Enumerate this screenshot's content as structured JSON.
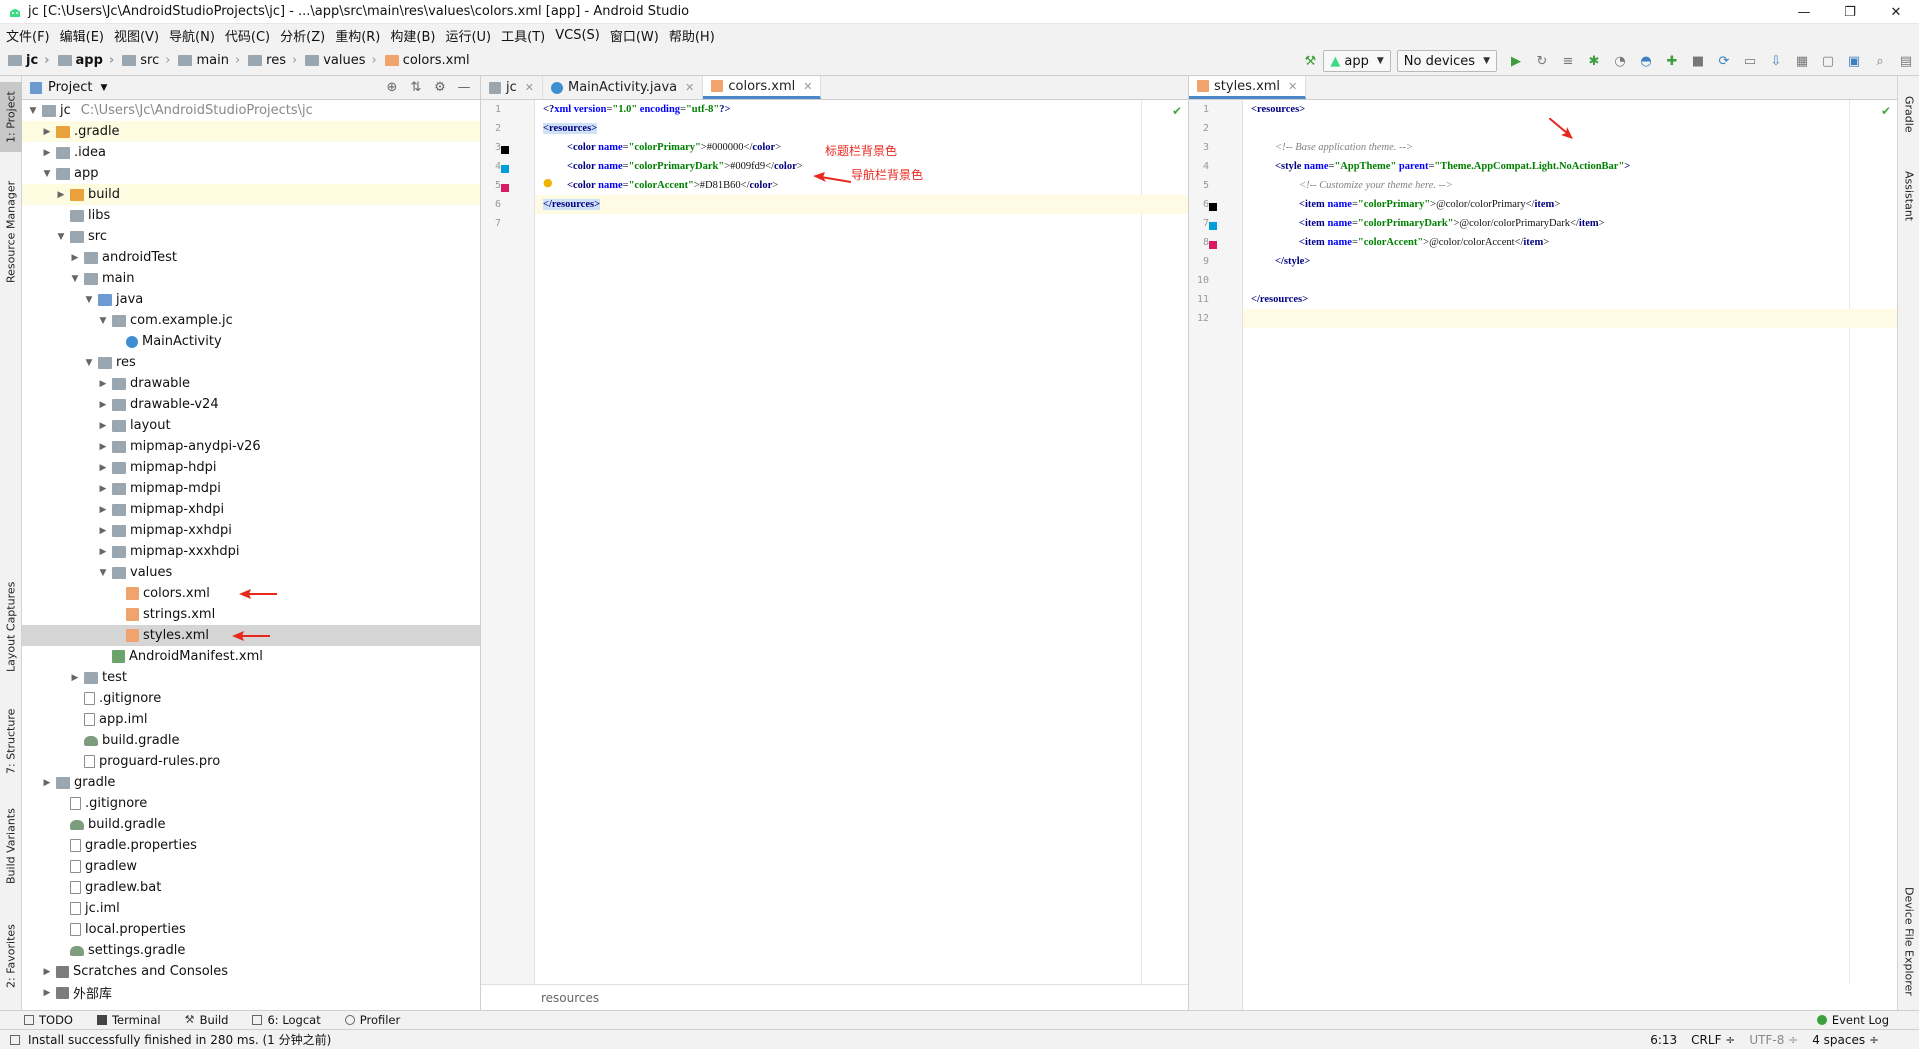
{
  "window": {
    "title": "jc [C:\\Users\\Jc\\AndroidStudioProjects\\jc] - ...\\app\\src\\main\\res\\values\\colors.xml [app] - Android Studio",
    "minimize": "—",
    "maximize": "❐",
    "close": "✕"
  },
  "menu": [
    "文件(F)",
    "编辑(E)",
    "视图(V)",
    "导航(N)",
    "代码(C)",
    "分析(Z)",
    "重构(R)",
    "构建(B)",
    "运行(U)",
    "工具(T)",
    "VCS(S)",
    "窗口(W)",
    "帮助(H)"
  ],
  "breadcrumb": [
    "jc",
    "app",
    "src",
    "main",
    "res",
    "values",
    "colors.xml"
  ],
  "toolbar": {
    "run_config": "app",
    "device": "No devices"
  },
  "left_stripe": {
    "project": "1: Project",
    "resource_manager": "Resource Manager",
    "layout_captures": "Layout Captures",
    "structure": "7: Structure",
    "build_variants": "Build Variants",
    "favorites": "2: Favorites"
  },
  "right_stripe": {
    "gradle": "Gradle",
    "assistant": "Assistant",
    "device_file_explorer": "Device File Explorer"
  },
  "project_panel": {
    "title": "Project",
    "root_name": "jc",
    "root_path": "C:\\Users\\Jc\\AndroidStudioProjects\\jc",
    "items": [
      {
        "label": ".gradle"
      },
      {
        "label": ".idea"
      },
      {
        "label": "app"
      },
      {
        "label": "build"
      },
      {
        "label": "libs"
      },
      {
        "label": "src"
      },
      {
        "label": "androidTest"
      },
      {
        "label": "main"
      },
      {
        "label": "java"
      },
      {
        "label": "com.example.jc"
      },
      {
        "label": "MainActivity"
      },
      {
        "label": "res"
      },
      {
        "label": "drawable"
      },
      {
        "label": "drawable-v24"
      },
      {
        "label": "layout"
      },
      {
        "label": "mipmap-anydpi-v26"
      },
      {
        "label": "mipmap-hdpi"
      },
      {
        "label": "mipmap-mdpi"
      },
      {
        "label": "mipmap-xhdpi"
      },
      {
        "label": "mipmap-xxhdpi"
      },
      {
        "label": "mipmap-xxxhdpi"
      },
      {
        "label": "values"
      },
      {
        "label": "colors.xml"
      },
      {
        "label": "strings.xml"
      },
      {
        "label": "styles.xml"
      },
      {
        "label": "AndroidManifest.xml"
      },
      {
        "label": "test"
      },
      {
        "label": ".gitignore"
      },
      {
        "label": "app.iml"
      },
      {
        "label": "build.gradle"
      },
      {
        "label": "proguard-rules.pro"
      },
      {
        "label": "gradle"
      },
      {
        "label": ".gitignore"
      },
      {
        "label": "build.gradle"
      },
      {
        "label": "gradle.properties"
      },
      {
        "label": "gradlew"
      },
      {
        "label": "gradlew.bat"
      },
      {
        "label": "jc.iml"
      },
      {
        "label": "local.properties"
      },
      {
        "label": "settings.gradle"
      },
      {
        "label": "Scratches and Consoles"
      },
      {
        "label": "外部库"
      }
    ]
  },
  "editor_left": {
    "tabs": [
      "jc",
      "MainActivity.java",
      "colors.xml"
    ],
    "line_numbers": [
      "1",
      "2",
      "3",
      "4",
      "5",
      "6",
      "7"
    ],
    "lines": {
      "l1_a": "<?",
      "l1_b": "xml version",
      "l1_c": "=",
      "l1_d": "\"1.0\"",
      "l1_e": " encoding",
      "l1_f": "=",
      "l1_g": "\"utf-8\"",
      "l1_h": "?>",
      "l2": "<resources>",
      "l3_a": "<color ",
      "l3_b": "name",
      "l3_c": "=",
      "l3_d": "\"colorPrimary\"",
      "l3_e": ">#000000</",
      "l3_f": "color",
      "l3_g": ">",
      "l4_a": "<color ",
      "l4_b": "name",
      "l4_c": "=",
      "l4_d": "\"colorPrimaryDark\"",
      "l4_e": ">#009fd9</",
      "l4_f": "color",
      "l4_g": ">",
      "l5_a": "<color ",
      "l5_b": "name",
      "l5_c": "=",
      "l5_d": "\"colorAccent\"",
      "l5_e": ">#D81B60</",
      "l5_f": "color",
      "l5_g": ">",
      "l6": "</resources>"
    },
    "annotation_title": "标题栏背景色",
    "annotation_nav": "导航栏背景色",
    "footer": "resources",
    "swatch_colors": [
      "#000000",
      "#009fd9",
      "#D81B60"
    ]
  },
  "editor_right": {
    "tabs": [
      "styles.xml"
    ],
    "line_numbers": [
      "1",
      "2",
      "3",
      "4",
      "5",
      "6",
      "7",
      "8",
      "9",
      "10",
      "11",
      "12"
    ],
    "lines": {
      "l1": "<resources>",
      "l3": "<!-- Base application theme. -->",
      "l4_a": "<style ",
      "l4_b": "name",
      "l4_c": "=",
      "l4_d": "\"AppTheme\"",
      "l4_e": " parent",
      "l4_f": "=",
      "l4_g": "\"Theme.AppCompat.Light.NoActionBar\"",
      "l4_h": ">",
      "l5": "<!-- Customize your theme here. -->",
      "l6_a": "<item ",
      "l6_b": "name",
      "l6_c": "=",
      "l6_d": "\"colorPrimary\"",
      "l6_e": ">@color/colorPrimary</",
      "l6_f": "item",
      "l6_g": ">",
      "l7_a": "<item ",
      "l7_b": "name",
      "l7_c": "=",
      "l7_d": "\"colorPrimaryDark\"",
      "l7_e": ">@color/colorPrimaryDark</",
      "l7_f": "item",
      "l7_g": ">",
      "l8_a": "<item ",
      "l8_b": "name",
      "l8_c": "=",
      "l8_d": "\"colorAccent\"",
      "l8_e": ">@color/colorAccent</",
      "l8_f": "item",
      "l8_g": ">",
      "l9": "</style>",
      "l11": "</resources>"
    }
  },
  "bottom_tools": [
    "TODO",
    "Terminal",
    "Build",
    "6: Logcat",
    "Profiler"
  ],
  "event_log": "Event Log",
  "status": {
    "message": "Install successfully finished in 280 ms. (1 分钟之前)",
    "position": "6:13",
    "line_sep": "CRLF ÷",
    "encoding": "UTF-8 ÷",
    "indent": "4 spaces ÷"
  },
  "colors": {
    "accent_blue": "#4a88c7",
    "annotation_red": "#e8281f"
  }
}
